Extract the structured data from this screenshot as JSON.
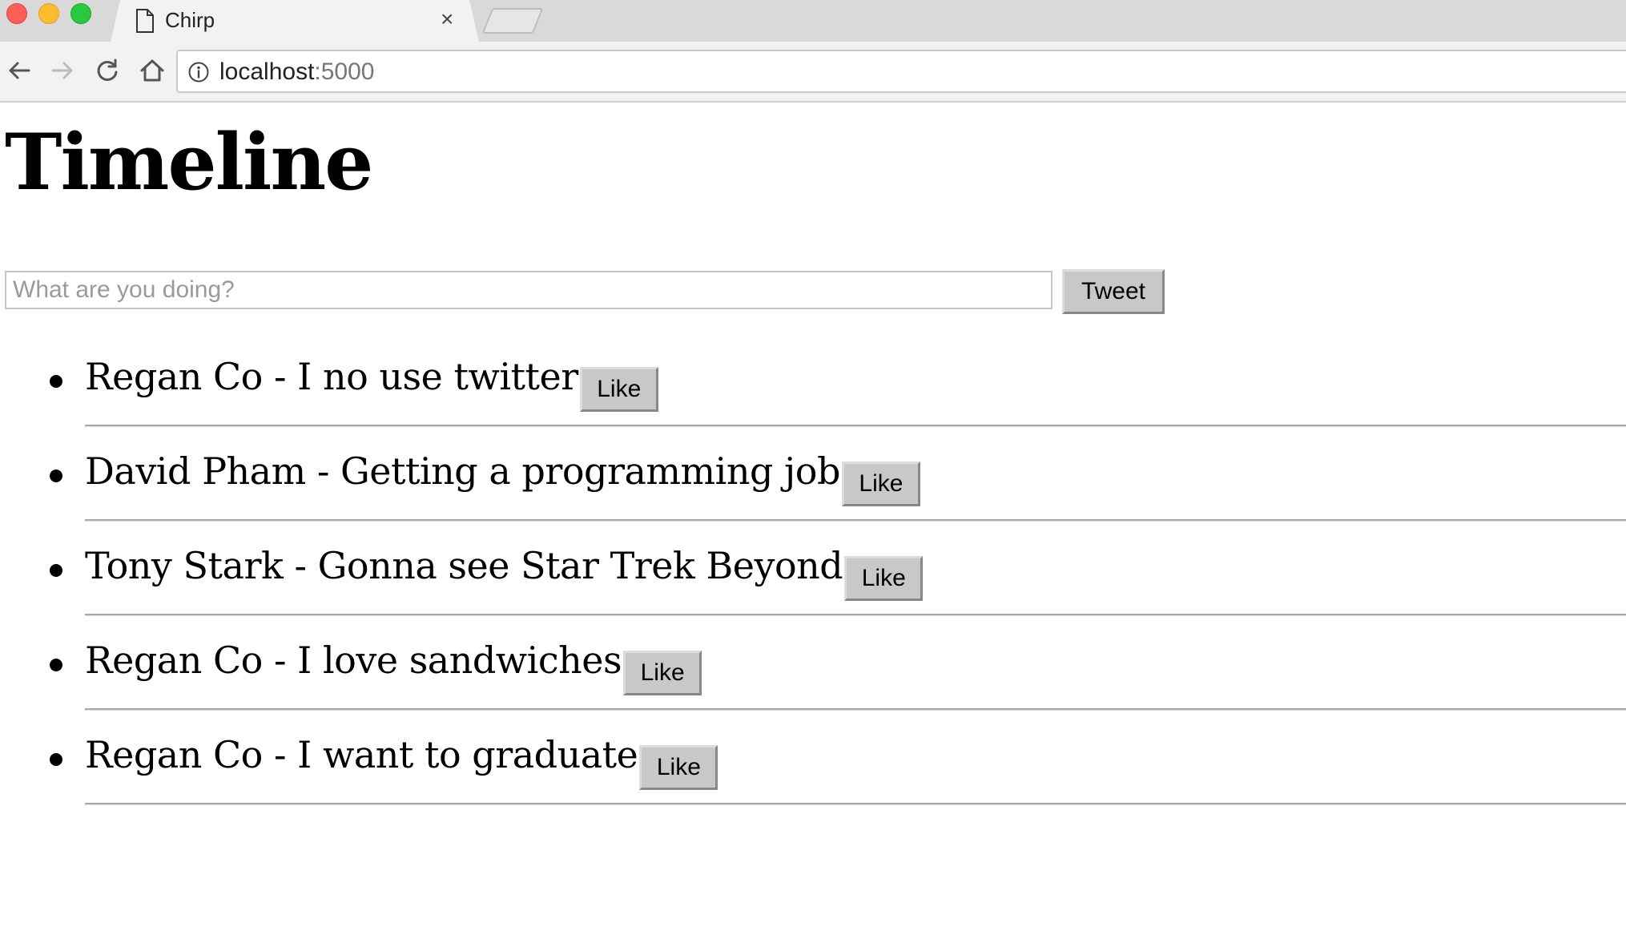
{
  "browser": {
    "tab": {
      "title": "Chirp",
      "close": "×"
    },
    "address": {
      "host": "localhost",
      "port": ":5000"
    }
  },
  "page": {
    "title": "Timeline",
    "compose": {
      "placeholder": "What are you doing?",
      "value": "",
      "button_label": "Tweet"
    },
    "tweets": [
      {
        "author": "Regan Co",
        "separator": " - ",
        "text": "I no use twitter",
        "like_label": "Like"
      },
      {
        "author": "David Pham",
        "separator": " - ",
        "text": "Getting a programming job",
        "like_label": "Like"
      },
      {
        "author": "Tony Stark",
        "separator": " - ",
        "text": "Gonna see Star Trek Beyond",
        "like_label": "Like"
      },
      {
        "author": "Regan Co",
        "separator": " - ",
        "text": "I love sandwiches",
        "like_label": "Like"
      },
      {
        "author": "Regan Co",
        "separator": " - ",
        "text": "I want to graduate",
        "like_label": "Like"
      }
    ]
  },
  "icons": {
    "tab": "page-icon",
    "back": "arrow-left-icon",
    "forward": "arrow-right-icon",
    "reload": "reload-icon",
    "home": "home-icon",
    "site_info": "info-icon"
  }
}
